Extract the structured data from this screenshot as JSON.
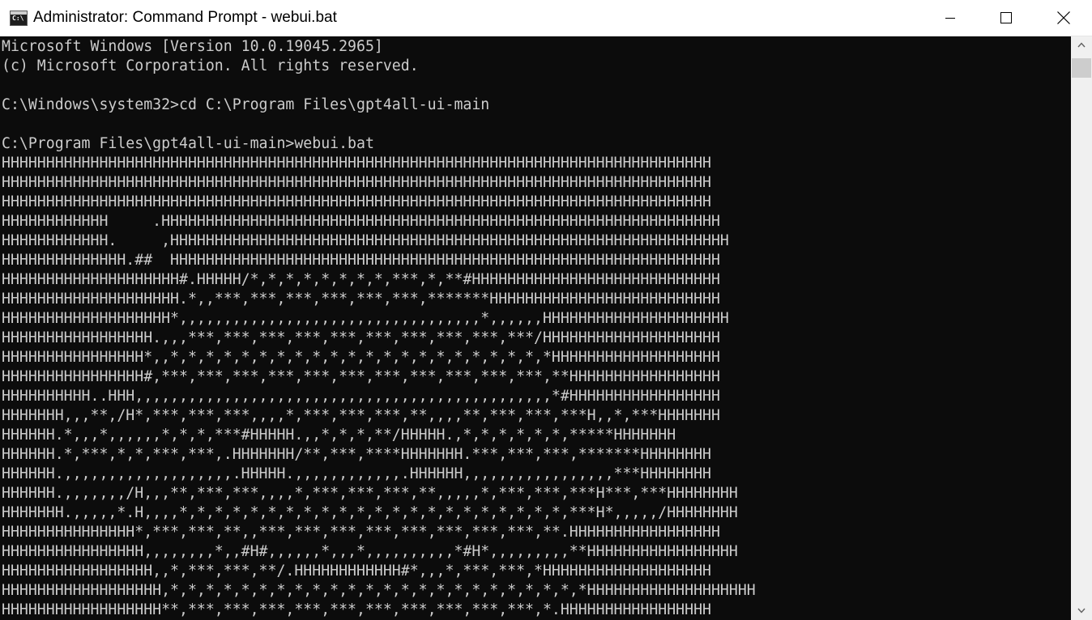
{
  "window": {
    "title": "Administrator: Command Prompt - webui.bat",
    "icon": "cmd-icon",
    "icon_text": "C:\\"
  },
  "controls": {
    "minimize": "minimize-icon",
    "maximize": "maximize-icon",
    "close": "close-icon"
  },
  "console": {
    "lines": [
      "Microsoft Windows [Version 10.0.19045.2965]",
      "(c) Microsoft Corporation. All rights reserved.",
      "",
      "C:\\Windows\\system32>cd C:\\Program Files\\gpt4all-ui-main",
      "",
      "C:\\Program Files\\gpt4all-ui-main>webui.bat",
      "HHHHHHHHHHHHHHHHHHHHHHHHHHHHHHHHHHHHHHHHHHHHHHHHHHHHHHHHHHHHHHHHHHHHHHHHHHHHHHHH",
      "HHHHHHHHHHHHHHHHHHHHHHHHHHHHHHHHHHHHHHHHHHHHHHHHHHHHHHHHHHHHHHHHHHHHHHHHHHHHHHHH",
      "HHHHHHHHHHHHHHHHHHHHHHHHHHHHHHHHHHHHHHHHHHHHHHHHHHHHHHHHHHHHHHHHHHHHHHHHHHHHHHHH",
      "HHHHHHHHHHHH     .HHHHHHHHHHHHHHHHHHHHHHHHHHHHHHHHHHHHHHHHHHHHHHHHHHHHHHHHHHHHHHH",
      "HHHHHHHHHHHH.     ,HHHHHHHHHHHHHHHHHHHHHHHHHHHHHHHHHHHHHHHHHHHHHHHHHHHHHHHHHHHHHHH",
      "HHHHHHHHHHHHHH.##  HHHHHHHHHHHHHHHHHHHHHHHHHHHHHHHHHHHHHHHHHHHHHHHHHHHHHHHHHHHHHH",
      "HHHHHHHHHHHHHHHHHHHH#.HHHHH/*,*,*,*,*,*,*,*,***,*,**#HHHHHHHHHHHHHHHHHHHHHHHHHHHH",
      "HHHHHHHHHHHHHHHHHHHH.*,,***,***,***,***,***,***,*******HHHHHHHHHHHHHHHHHHHHHHHHHH",
      "HHHHHHHHHHHHHHHHHHH*,,,,,,,,,,,,,,,,,,,,,,,,,,,,,,,,,,*,,,,,,HHHHHHHHHHHHHHHHHHHHH",
      "HHHHHHHHHHHHHHHHH.,,,***,***,***,***,***,***,***,***,***,***/HHHHHHHHHHHHHHHHHHHH",
      "HHHHHHHHHHHHHHHH*,,*,*,*,*,*,*,*,*,*,*,*,*,*,*,*,*,*,*,*,*,*,*HHHHHHHHHHHHHHHHHHH",
      "HHHHHHHHHHHHHHHH#,***,***,***,***,***,***,***,***,***,***,***,**HHHHHHHHHHHHHHHHH",
      "HHHHHHHHHH..HHH,,,,,,,,,,,,,,,,,,,,,,,,,,,,,,,,,,,,,,,,,,,,,,,*#HHHHHHHHHHHHHHHHH",
      "HHHHHHH,,,**,/H*,***,***,***,,,,*,***,***,***,**,,,,**,***,***,***H,,*,***HHHHHHH",
      "HHHHHH.*,,,*,,,,,,*,*,*,***#HHHHH.,,*,*,*,**/HHHHH.,*,*,*,*,*,*,*****HHHHHHH",
      "HHHHHH.*,***,*,*,***,***,.HHHHHHH/**,***,****HHHHHHH.***,***,***,*******HHHHHHHH",
      "HHHHHH.,,,,,,,,,,,,,,,,,,,.HHHHH.,,,,,,,,,,,,.HHHHHH,,,,,,,,,,,,,,,,,***HHHHHHHH",
      "HHHHHH.,,,,,,,/H,,,**,***,***,,,,*,***,***,***,**,,,,,*,***,***,***H***,***HHHHHHHH",
      "HHHHHHH.,,,,,*.H,,,,*,*,*,*,*,*,*,*,*,*,*,*,*,*,*,*,*,*,*,*,*,*,***H*,,,,,/HHHHHHHH",
      "HHHHHHHHHHHHHHH*,***,***,**,,***,***,***,***,***,***,***,***,**.HHHHHHHHHHHHHHHHH",
      "HHHHHHHHHHHHHHHH,,,,,,,,*,,#H#,,,,,,*,,,*,,,,,,,,,,*#H*,,,,,,,,,**HHHHHHHHHHHHHHHHH",
      "HHHHHHHHHHHHHHHHH,,*,***,***,**/.HHHHHHHHHHHH#*,,,*,***,***,*HHHHHHHHHHHHHHHHHHH",
      "HHHHHHHHHHHHHHHHHH,*,*,*,*,*,*,*,*,*,*,*,*,*,*,*,*,*,*,*,*,*,*,*,*HHHHHHHHHHHHHHHHHHH",
      "HHHHHHHHHHHHHHHHHH**,***,***,***,***,***,***,***,***,***,***,*.HHHHHHHHHHHHHHHHH"
    ]
  }
}
